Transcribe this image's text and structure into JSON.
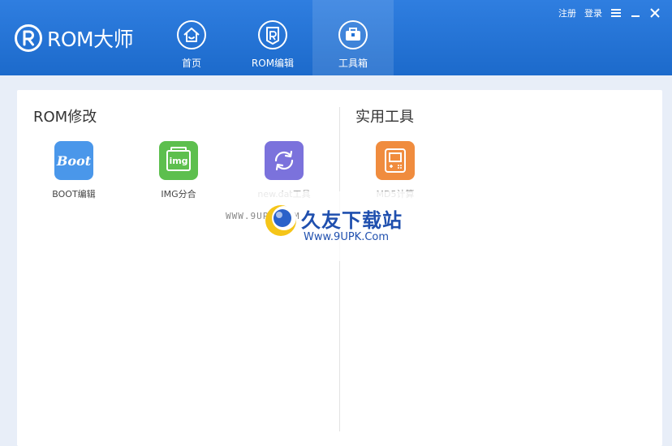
{
  "app": {
    "name": "ROM大师"
  },
  "nav": [
    {
      "label": "首页",
      "icon": "home-icon"
    },
    {
      "label": "ROM编辑",
      "icon": "rom-edit-icon"
    },
    {
      "label": "工具箱",
      "icon": "toolbox-icon",
      "active": true
    }
  ],
  "top_links": {
    "register": "注册",
    "login": "登录"
  },
  "sections": {
    "rom": {
      "title": "ROM修改"
    },
    "utils": {
      "title": "实用工具"
    }
  },
  "tools": {
    "boot": {
      "label": "BOOT编辑",
      "icon_text": "Boot",
      "color": "#4a97ea"
    },
    "img": {
      "label": "IMG分合",
      "icon_text": "img",
      "color": "#5dbf4e"
    },
    "newdat": {
      "label": "new.dat工具",
      "color": "#7b72dc"
    },
    "md5": {
      "label": "MD5计算",
      "color": "#f08c3e"
    }
  },
  "watermark": {
    "left": "WWW.9UPK.COM",
    "big": "久友下载站",
    "small": "Www.9UPK.Com"
  },
  "colors": {
    "header": "#2372d6",
    "panel": "#ffffff",
    "background": "#e8eef8"
  }
}
